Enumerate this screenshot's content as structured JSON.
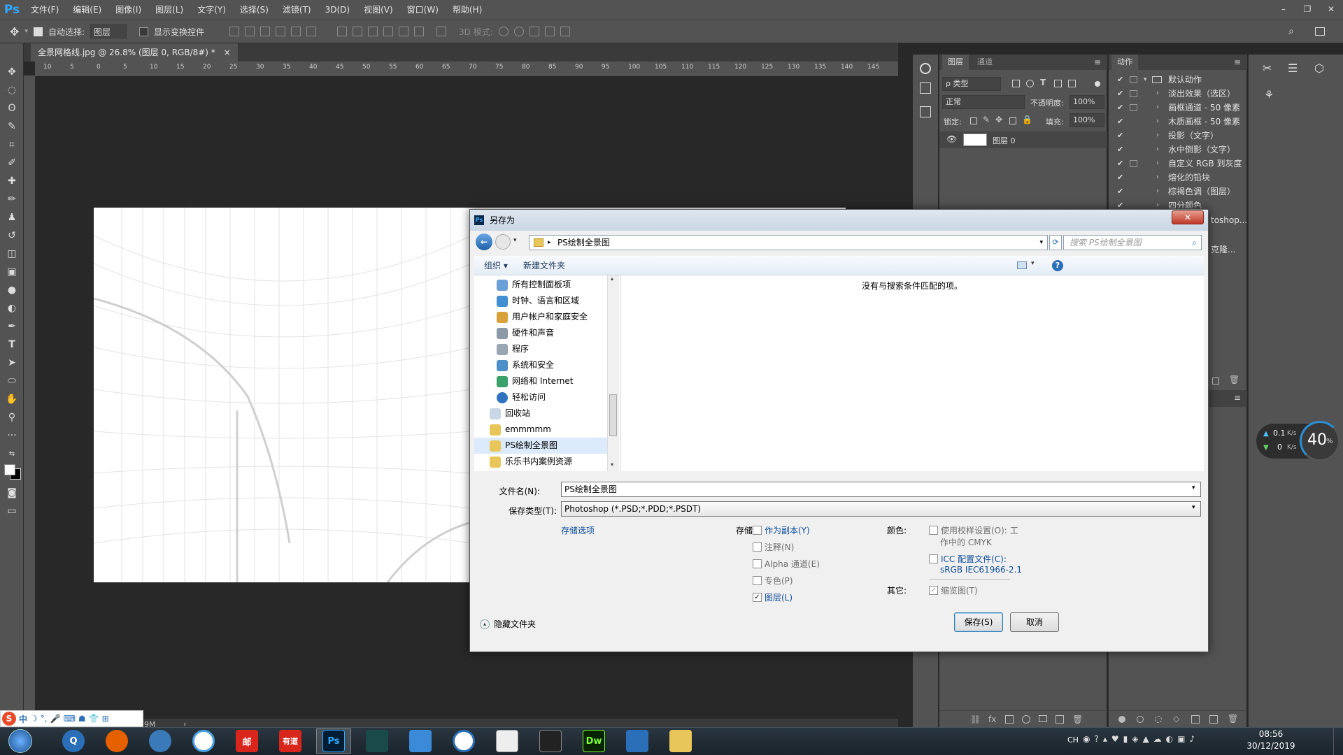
{
  "app": {
    "logo": "Ps",
    "menu": [
      "文件(F)",
      "编辑(E)",
      "图像(I)",
      "图层(L)",
      "文字(Y)",
      "选择(S)",
      "滤镜(T)",
      "3D(D)",
      "视图(V)",
      "窗口(W)",
      "帮助(H)"
    ]
  },
  "options_bar": {
    "auto_select_label": "自动选择:",
    "auto_select_value": "图层",
    "show_transform_label": "显示变换控件",
    "mode_3d_label": "3D 模式:"
  },
  "document": {
    "tab_title": "全景网格线.jpg @ 26.8% (图层 0, RGB/8#) *",
    "close_glyph": "×",
    "ruler_ticks": [
      "10",
      "5",
      "0",
      "5",
      "10",
      "15",
      "20",
      "25",
      "30",
      "35",
      "40",
      "45",
      "50",
      "55",
      "60",
      "65",
      "70",
      "75",
      "80",
      "85",
      "90",
      "95",
      "100",
      "105",
      "110",
      "115",
      "120",
      "125",
      "130",
      "135",
      "140",
      "145"
    ],
    "status_text": "9M"
  },
  "layers_panel": {
    "tabs": [
      "图层",
      "通道"
    ],
    "filter_label": "ρ 类型",
    "blend_mode": "正常",
    "opacity_label": "不透明度:",
    "opacity_value": "100%",
    "lock_label": "锁定:",
    "fill_label": "填充:",
    "fill_value": "100%",
    "layer_name": "图层 0"
  },
  "actions_panel": {
    "tab": "动作",
    "set_name": "默认动作",
    "items": [
      "淡出效果（选区）",
      "画框通道 - 50 像素",
      "木质画框 - 50 像素",
      "投影（文字）",
      "水中倒影（文字）",
      "自定义 RGB 到灰度",
      "熔化的铅块",
      "棕褐色调（图层）",
      "四分颜色"
    ],
    "partial_1": "toshop...",
    "partial_2": "克隆..."
  },
  "speed_widget": {
    "up": "0.1",
    "up_unit": "K/s",
    "down": "0",
    "down_unit": "K/s",
    "percent": "40",
    "percent_unit": "%"
  },
  "dialog": {
    "title": "另存为",
    "path": "PS绘制全景图",
    "search_placeholder": "搜索 PS绘制全景图",
    "organize": "组织 ▾",
    "new_folder": "新建文件夹",
    "empty_msg": "没有与搜索条件匹配的项。",
    "nav_items": [
      "所有控制面板项",
      "时钟、语言和区域",
      "用户帐户和家庭安全",
      "硬件和声音",
      "程序",
      "系统和安全",
      "网络和 Internet",
      "轻松访问",
      "回收站",
      "emmmmm",
      "PS绘制全景图",
      "乐乐书内案例资源"
    ],
    "filename_label": "文件名(N):",
    "filename_value": "PS绘制全景图",
    "filetype_label": "保存类型(T):",
    "filetype_value": "Photoshop (*.PSD;*.PDD;*.PSDT)",
    "save_options_link": "存储选项",
    "store_label": "存储:",
    "as_copy": "作为副本(Y)",
    "notes": "注释(N)",
    "alpha": "Alpha 通道(E)",
    "spot": "专色(P)",
    "layers": "图层(L)",
    "color_label": "颜色:",
    "proof_setup": "使用校样设置(O):",
    "proof_tail": "工",
    "cmyk": "作中的 CMYK",
    "icc": "ICC 配置文件(C):",
    "icc_value": "sRGB IEC61966-2.1",
    "other_label": "其它:",
    "thumbnail": "缩览图(T)",
    "hide_folders": "隐藏文件夹",
    "save_btn": "保存(S)",
    "cancel_btn": "取消"
  },
  "taskbar": {
    "lang": "CH",
    "time": "08:56",
    "date": "30/12/2019",
    "ime_logo": "S",
    "ime_mode": "中",
    "app_labels": {
      "ps": "Ps",
      "dw": "Dw",
      "mail": "邮",
      "youdao": "有道"
    }
  }
}
